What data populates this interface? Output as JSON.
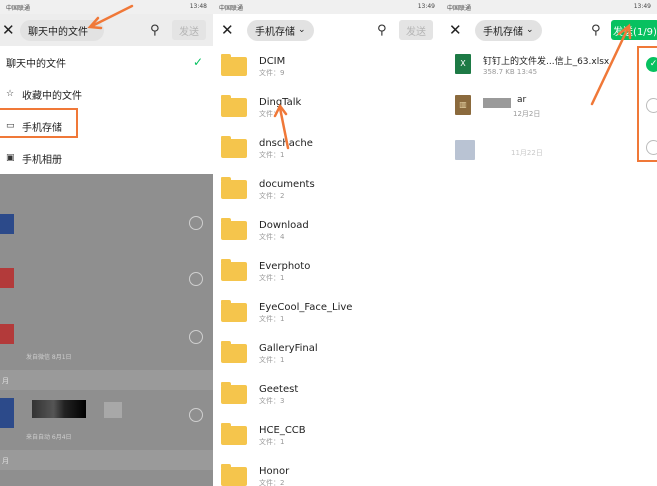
{
  "status_bar": {
    "carrier": "中国联通",
    "time_left": "13:48",
    "time_mid": "13:49",
    "time_right": "13:49"
  },
  "left": {
    "dropdown_label": "聊天中的文件",
    "send_label": "发送",
    "menu_items": [
      "聊天中的文件",
      "收藏中的文件",
      "手机存储",
      "手机相册"
    ],
    "dim_dates": [
      "发自微信 8月1日",
      "来自自动 6月4日"
    ],
    "dim_months": [
      "月",
      "月"
    ]
  },
  "middle": {
    "dropdown_label": "手机存储",
    "send_label": "发送",
    "folders": [
      {
        "name": "DCIM",
        "count": "文件：9"
      },
      {
        "name": "DingTalk",
        "count": "文件："
      },
      {
        "name": "dnschache",
        "count": "文件：1"
      },
      {
        "name": "documents",
        "count": "文件：2"
      },
      {
        "name": "Download",
        "count": "文件：4"
      },
      {
        "name": "Everphoto",
        "count": "文件：1"
      },
      {
        "name": "EyeCool_Face_Live",
        "count": "文件：1"
      },
      {
        "name": "GalleryFinal",
        "count": "文件：1"
      },
      {
        "name": "Geetest",
        "count": "文件：3"
      },
      {
        "name": "HCE_CCB",
        "count": "文件：1"
      },
      {
        "name": "Honor",
        "count": "文件：2"
      }
    ]
  },
  "right": {
    "dropdown_label": "手机存储",
    "send_label": "发送(1/9)",
    "files": [
      {
        "name": "钉钉上的文件发...信上_63.xlsx",
        "meta": "358.7 KB  13:45",
        "icon": "X",
        "selected": true
      },
      {
        "name": "ar",
        "meta": "12月2日",
        "icon": "rar",
        "selected": false
      },
      {
        "name": "",
        "meta": "11月22日",
        "icon": "img",
        "selected": false
      }
    ]
  },
  "colors": {
    "accent_green": "#07c160",
    "annotation_orange": "#f07838",
    "folder_yellow": "#f5c54c"
  }
}
